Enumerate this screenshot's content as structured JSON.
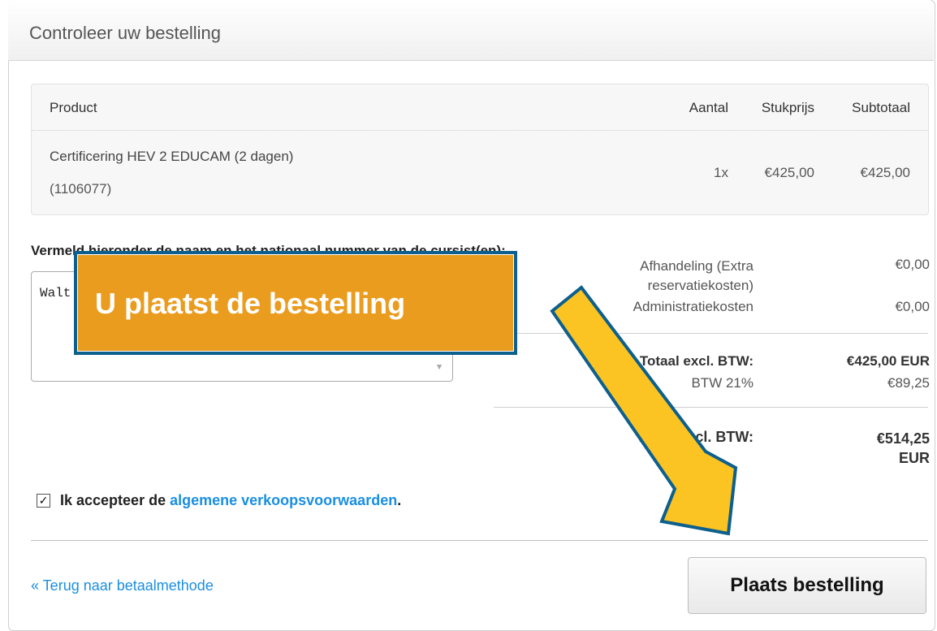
{
  "header": {
    "title": "Controleer uw bestelling"
  },
  "order_table": {
    "columns": [
      "Product",
      "Aantal",
      "Stukprijs",
      "Subtotaal"
    ],
    "rows": [
      {
        "product": "Certificering HEV 2 EDUCAM (2 dagen)",
        "code": "(1106077)",
        "qty": "1x",
        "unit_price": "€425,00",
        "subtotal": "€425,00"
      }
    ]
  },
  "note": {
    "label": "Vermeld hieronder de naam en het nationaal nummer van de cursist(en):",
    "value": "Walt"
  },
  "summary": {
    "handling_label": "Afhandeling (Extra reservatiekosten)",
    "handling_value": "€0,00",
    "admin_label": "Administratiekosten",
    "admin_value": "€0,00",
    "total_excl_label": "Totaal excl. BTW:",
    "total_excl_value": "€425,00 EUR",
    "vat_label": "BTW 21%",
    "vat_value": "€89,25",
    "total_incl_label": "Totaal incl. BTW:",
    "total_incl_value": "€514,25 EUR"
  },
  "terms": {
    "checked": true,
    "prefix": "Ik accepteer de ",
    "link": "algemene verkoopsvoorwaarden",
    "suffix": "."
  },
  "footer": {
    "back_link": "« Terug naar betaalmethode",
    "place_button": "Plaats bestelling"
  },
  "annotation": {
    "callout_text": "U plaatst de bestelling",
    "callout_color": "#ea9c1f",
    "callout_border": "#0d5f8d",
    "arrow_color": "#fbc422"
  }
}
